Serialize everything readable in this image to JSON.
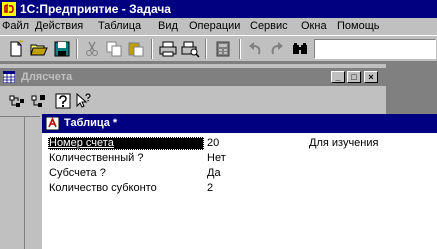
{
  "app": {
    "title": "1С:Предприятие - Задача"
  },
  "menu": {
    "items": [
      {
        "label": "Файл"
      },
      {
        "label": "Действия"
      },
      {
        "label": "Таблица"
      },
      {
        "label": "Вид"
      },
      {
        "label": "Операции"
      },
      {
        "label": "Сервис"
      },
      {
        "label": "Окна"
      },
      {
        "label": "Помощь"
      }
    ]
  },
  "toolbar": {
    "search_value": "",
    "icons": [
      "new-document-icon",
      "open-folder-icon",
      "save-icon",
      "cut-icon",
      "copy-icon",
      "paste-icon",
      "print-icon",
      "print-preview-icon",
      "calculator-icon",
      "undo-icon",
      "redo-icon",
      "find-icon"
    ]
  },
  "bg_window": {
    "title": "Дляcчета",
    "controls": {
      "minimize": "_",
      "maximize": "□",
      "close": "×"
    }
  },
  "table_window": {
    "title": "Таблица *",
    "rows": [
      {
        "name": "Номер счета",
        "value": "20",
        "note": "Для изучения"
      },
      {
        "name": "Количественный ?",
        "value": "Нет",
        "note": ""
      },
      {
        "name": "Субсчета ?",
        "value": "Да",
        "note": ""
      },
      {
        "name": "Количество субконто",
        "value": "2",
        "note": ""
      }
    ]
  },
  "colors": {
    "active_title": "#000080",
    "inactive_title": "#808080",
    "face": "#c0c0c0",
    "desktop": "#808080"
  }
}
